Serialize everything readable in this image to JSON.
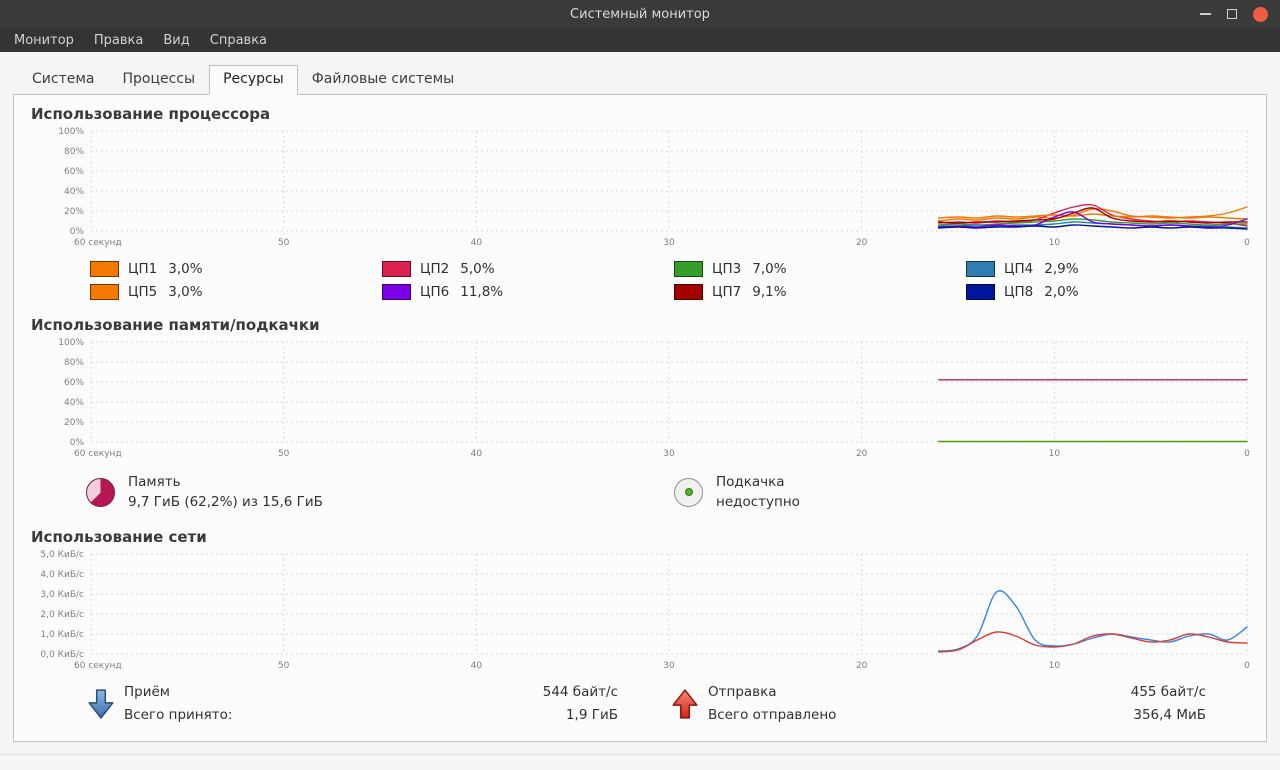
{
  "window": {
    "title": "Системный монитор"
  },
  "colors": {
    "close_button": "#f25b43"
  },
  "menubar": {
    "items": [
      "Монитор",
      "Правка",
      "Вид",
      "Справка"
    ]
  },
  "tabs": {
    "labels": [
      "Система",
      "Процессы",
      "Ресурсы",
      "Файловые системы"
    ],
    "active": "Ресурсы"
  },
  "cpu": {
    "heading": "Использование процессора",
    "legend": [
      {
        "label": "ЦП1",
        "value": "3,0%",
        "color": "#f57900"
      },
      {
        "label": "ЦП2",
        "value": "5,0%",
        "color": "#dc2050"
      },
      {
        "label": "ЦП3",
        "value": "7,0%",
        "color": "#33a02c"
      },
      {
        "label": "ЦП4",
        "value": "2,9%",
        "color": "#2e7db3"
      },
      {
        "label": "ЦП5",
        "value": "3,0%",
        "color": "#f57900"
      },
      {
        "label": "ЦП6",
        "value": "11,8%",
        "color": "#7c00e8"
      },
      {
        "label": "ЦП7",
        "value": "9,1%",
        "color": "#a40000"
      },
      {
        "label": "ЦП8",
        "value": "2,0%",
        "color": "#00169c"
      }
    ]
  },
  "memory": {
    "heading": "Использование памяти/подкачки",
    "mem_label": "Память",
    "mem_value": "9,7 ГиБ (62,2%) из 15,6 ГиБ",
    "mem_percent": 62.2,
    "pie_color": "#b61653",
    "pie_rest_color": "#f2cfdc",
    "swap_label": "Подкачка",
    "swap_value": "недоступно"
  },
  "network": {
    "heading": "Использование сети",
    "recv_label": "Приём",
    "recv_rate": "544 байт/с",
    "recv_total_label": "Всего принято:",
    "recv_total": "1,9 ГиБ",
    "send_label": "Отправка",
    "send_rate": "455 байт/с",
    "send_total_label": "Всего отправлено",
    "send_total": "356,4 МиБ"
  },
  "charts": {
    "cpu": {
      "type": "line",
      "y_min": 0,
      "y_max": 100,
      "x_span_seconds": 60,
      "y_tick_labels": [
        "100%",
        "80%",
        "60%",
        "40%",
        "20%",
        "0%"
      ],
      "x_tick_labels": [
        "60 секунд",
        "50",
        "40",
        "30",
        "20",
        "10",
        "0"
      ],
      "series": [
        {
          "name": "ЦП1",
          "color": "#f57900",
          "start": 16,
          "values": [
            10,
            12,
            11,
            13,
            12,
            14,
            13,
            16,
            22,
            20,
            15,
            14,
            13,
            14,
            15,
            18,
            24
          ]
        },
        {
          "name": "ЦП2",
          "color": "#dc2050",
          "start": 16,
          "values": [
            8,
            9,
            8,
            10,
            9,
            11,
            18,
            24,
            26,
            16,
            12,
            10,
            9,
            10,
            9,
            8,
            5
          ]
        },
        {
          "name": "ЦП3",
          "color": "#33a02c",
          "start": 16,
          "values": [
            6,
            7,
            6,
            7,
            8,
            9,
            10,
            12,
            11,
            9,
            8,
            7,
            8,
            7,
            6,
            7,
            7
          ]
        },
        {
          "name": "ЦП4",
          "color": "#2e7db3",
          "start": 16,
          "values": [
            5,
            5,
            6,
            5,
            6,
            6,
            7,
            9,
            8,
            7,
            6,
            5,
            6,
            5,
            5,
            4,
            3
          ]
        },
        {
          "name": "ЦП5",
          "color": "#f57900",
          "start": 16,
          "values": [
            13,
            14,
            13,
            15,
            14,
            15,
            16,
            15,
            17,
            15,
            14,
            15,
            14,
            13,
            14,
            13,
            12
          ]
        },
        {
          "name": "ЦП6",
          "color": "#7c00e8",
          "start": 16,
          "values": [
            4,
            5,
            4,
            6,
            5,
            6,
            14,
            19,
            9,
            7,
            6,
            5,
            6,
            5,
            4,
            6,
            12
          ]
        },
        {
          "name": "ЦП7",
          "color": "#a40000",
          "start": 16,
          "values": [
            9,
            8,
            9,
            9,
            10,
            11,
            12,
            18,
            23,
            13,
            10,
            9,
            10,
            9,
            8,
            9,
            9
          ]
        },
        {
          "name": "ЦП8",
          "color": "#00169c",
          "start": 16,
          "values": [
            3,
            4,
            3,
            4,
            4,
            5,
            4,
            6,
            5,
            4,
            3,
            4,
            3,
            4,
            3,
            3,
            2
          ]
        }
      ]
    },
    "memory": {
      "type": "line",
      "y_min": 0,
      "y_max": 100,
      "x_span_seconds": 60,
      "y_tick_labels": [
        "100%",
        "80%",
        "60%",
        "40%",
        "20%",
        "0%"
      ],
      "x_tick_labels": [
        "60 секунд",
        "50",
        "40",
        "30",
        "20",
        "10",
        "0"
      ],
      "series": [
        {
          "name": "Память",
          "color": "#c0215c",
          "start": 16,
          "values": [
            62.2,
            62.2
          ]
        },
        {
          "name": "Подкачка",
          "color": "#4e9a06",
          "start": 16,
          "values": [
            0.5,
            0.5
          ]
        }
      ]
    },
    "network": {
      "type": "line",
      "y_min": 0,
      "y_max": 5,
      "x_span_seconds": 60,
      "y_tick_labels": [
        "5,0 КиБ/c",
        "4,0 КиБ/c",
        "3,0 КиБ/c",
        "2,0 КиБ/c",
        "1,0 КиБ/c",
        "0,0 КиБ/c"
      ],
      "x_tick_labels": [
        "60 секунд",
        "50",
        "40",
        "30",
        "20",
        "10",
        "0"
      ],
      "series": [
        {
          "name": "Приём",
          "color": "#3584e4",
          "start": 16,
          "values": [
            0.15,
            0.25,
            0.9,
            3.1,
            2.4,
            0.7,
            0.4,
            0.5,
            0.8,
            1.0,
            0.85,
            0.7,
            0.6,
            0.9,
            1.0,
            0.7,
            1.35
          ]
        },
        {
          "name": "Отправка",
          "color": "#de3b30",
          "start": 16,
          "values": [
            0.1,
            0.2,
            0.7,
            1.1,
            0.9,
            0.45,
            0.35,
            0.5,
            0.9,
            1.0,
            0.8,
            0.6,
            0.7,
            1.0,
            0.85,
            0.6,
            0.55
          ]
        }
      ]
    }
  }
}
